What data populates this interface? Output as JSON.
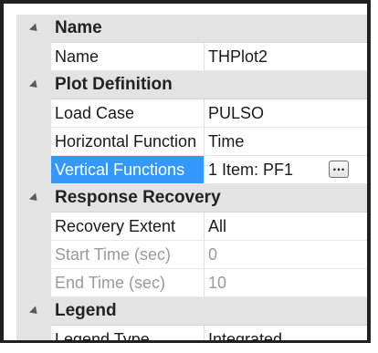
{
  "property_grid": {
    "categories": [
      {
        "title": "Name",
        "rows": [
          {
            "name": "Name",
            "value": "THPlot2"
          }
        ]
      },
      {
        "title": "Plot Definition",
        "rows": [
          {
            "name": "Load Case",
            "value": "PULSO"
          },
          {
            "name": "Horizontal Function",
            "value": "Time"
          },
          {
            "name": "Vertical Functions",
            "value": "1 Item: PF1",
            "button_label": "..."
          }
        ]
      },
      {
        "title": "Response Recovery",
        "rows": [
          {
            "name": "Recovery Extent",
            "value": "All"
          },
          {
            "name": "Start Time (sec)",
            "value": "0"
          },
          {
            "name": "End Time (sec)",
            "value": "10"
          }
        ]
      },
      {
        "title": "Legend",
        "rows": [
          {
            "name": "Legend Type",
            "value": "Integrated"
          }
        ]
      }
    ],
    "colors": {
      "selection": "#3399ff",
      "category_background": "#e3e3e3",
      "disabled_text": "#9a9a9a"
    }
  }
}
